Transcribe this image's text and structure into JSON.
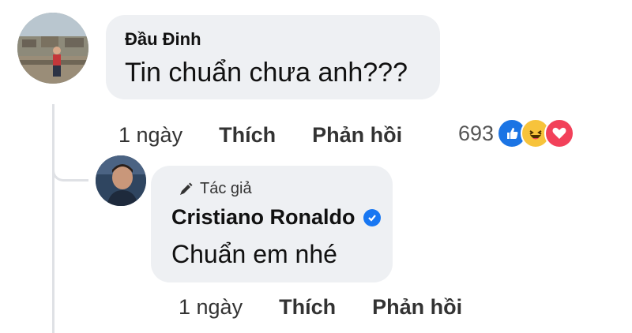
{
  "comment": {
    "author": "Đầu Đinh",
    "text": "Tin chuẩn chưa anh???",
    "time": "1 ngày",
    "like_label": "Thích",
    "reply_label": "Phản hồi",
    "reaction_count": "693",
    "reactions": [
      "like-icon",
      "haha-icon",
      "love-icon"
    ]
  },
  "reply": {
    "role_label": "Tác giả",
    "author": "Cristiano Ronaldo",
    "text": "Chuẩn em nhé",
    "time": "1 ngày",
    "like_label": "Thích",
    "reply_label": "Phản hồi"
  },
  "colors": {
    "bubble": "#eef0f3",
    "accent": "#1877f2",
    "haha": "#f7c33b",
    "love": "#f2415a"
  }
}
